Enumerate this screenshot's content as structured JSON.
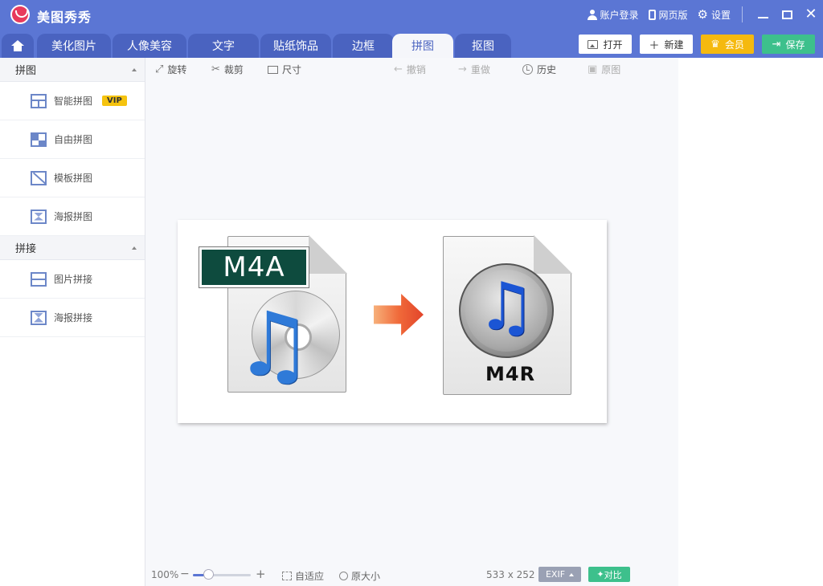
{
  "app": {
    "title": "美图秀秀"
  },
  "titlebar": {
    "login": "账户登录",
    "web": "网页版",
    "settings": "设置"
  },
  "tabs": [
    {
      "label": "美化图片"
    },
    {
      "label": "人像美容"
    },
    {
      "label": "文字"
    },
    {
      "label": "贴纸饰品"
    },
    {
      "label": "边框"
    },
    {
      "label": "拼图"
    },
    {
      "label": "抠图"
    }
  ],
  "actions": {
    "open": "打开",
    "new": "新建",
    "vip": "会员",
    "save": "保存"
  },
  "sidebar": {
    "group1": {
      "title": "拼图",
      "items": [
        {
          "label": "智能拼图",
          "badge": "VIP"
        },
        {
          "label": "自由拼图"
        },
        {
          "label": "模板拼图"
        },
        {
          "label": "海报拼图"
        }
      ]
    },
    "group2": {
      "title": "拼接",
      "items": [
        {
          "label": "图片拼接"
        },
        {
          "label": "海报拼接"
        }
      ]
    }
  },
  "toolbar": {
    "rotate": "旋转",
    "crop": "裁剪",
    "size": "尺寸",
    "undo": "撤销",
    "redo": "重做",
    "history": "历史",
    "original": "原图"
  },
  "canvas": {
    "left_label": "M4A",
    "right_label": "M4R"
  },
  "status": {
    "zoom": "100%",
    "zoom_level": 0.28,
    "fit": "自适应",
    "original_size": "原大小",
    "dimensions": "533 x 252",
    "exif": "EXIF",
    "compare": "对比"
  },
  "colors": {
    "header": "#5b76d4",
    "tab": "#4a63c0",
    "vip": "#f5b90f",
    "save": "#3dc08c"
  },
  "icons": {
    "home": "home-icon",
    "user": "user-icon",
    "phone": "phone-icon",
    "gear": "gear-icon",
    "minimize": "minimize-icon",
    "maximize": "maximize-icon",
    "close": "close-icon"
  }
}
